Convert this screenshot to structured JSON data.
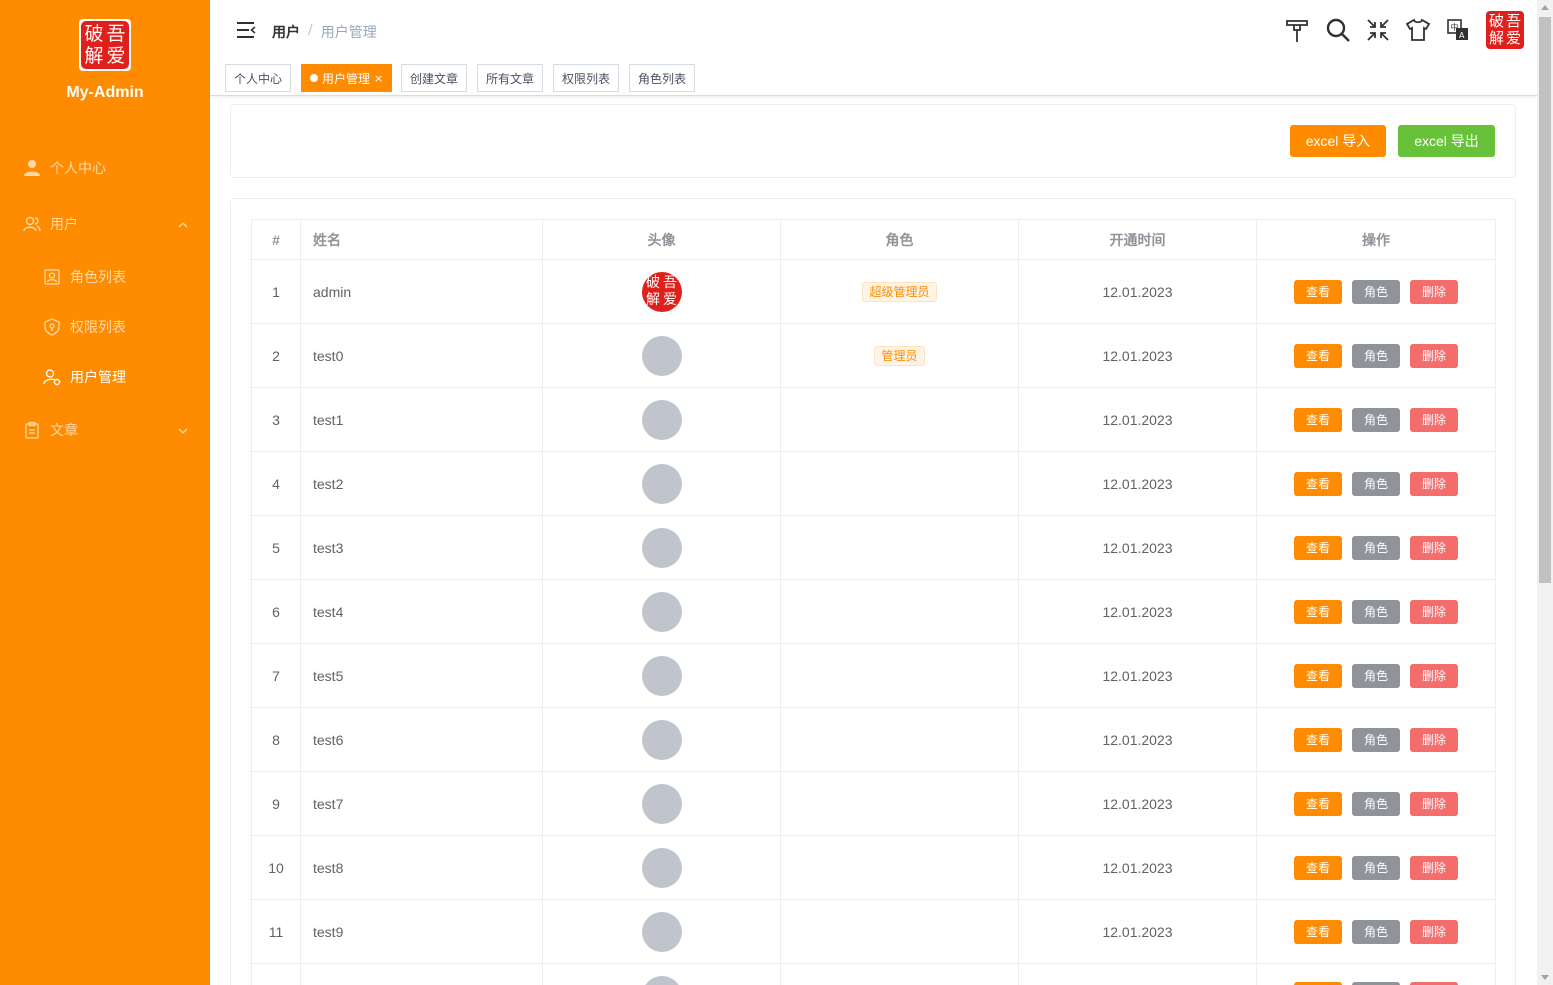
{
  "app": {
    "brand": "My-Admin",
    "logo_chars": [
      "破",
      "吾",
      "解",
      "爱"
    ]
  },
  "sidebar": {
    "items": [
      {
        "label": "个人中心",
        "icon": "user-icon"
      },
      {
        "label": "用户",
        "icon": "users-icon"
      },
      {
        "label": "角色列表",
        "icon": "role-icon"
      },
      {
        "label": "权限列表",
        "icon": "shield-icon"
      },
      {
        "label": "用户管理",
        "icon": "user-manage-icon"
      },
      {
        "label": "文章",
        "icon": "clipboard-icon"
      }
    ]
  },
  "header": {
    "breadcrumb": [
      "用户",
      "/",
      "用户管理"
    ],
    "icons": [
      "size-icon",
      "search-icon",
      "fullscreen-exit-icon",
      "theme-shirt-icon",
      "language-icon"
    ]
  },
  "tags": [
    {
      "label": "个人中心"
    },
    {
      "label": "用户管理",
      "close": "×"
    },
    {
      "label": "创建文章"
    },
    {
      "label": "所有文章"
    },
    {
      "label": "权限列表"
    },
    {
      "label": "角色列表"
    }
  ],
  "toolbar": {
    "import_label": "excel 导入",
    "export_label": "excel 导出"
  },
  "table": {
    "columns": [
      "#",
      "姓名",
      "头像",
      "角色",
      "开通时间",
      "操作"
    ],
    "actions": {
      "view": "查看",
      "role": "角色",
      "delete": "删除"
    },
    "rows": [
      {
        "index": "1",
        "name": "admin",
        "role": "超级管理员",
        "date": "12.01.2023",
        "avatar": "seal"
      },
      {
        "index": "2",
        "name": "test0",
        "role": "管理员",
        "date": "12.01.2023",
        "avatar": "placeholder"
      },
      {
        "index": "3",
        "name": "test1",
        "role": "",
        "date": "12.01.2023",
        "avatar": "placeholder"
      },
      {
        "index": "4",
        "name": "test2",
        "role": "",
        "date": "12.01.2023",
        "avatar": "placeholder"
      },
      {
        "index": "5",
        "name": "test3",
        "role": "",
        "date": "12.01.2023",
        "avatar": "placeholder"
      },
      {
        "index": "6",
        "name": "test4",
        "role": "",
        "date": "12.01.2023",
        "avatar": "placeholder"
      },
      {
        "index": "7",
        "name": "test5",
        "role": "",
        "date": "12.01.2023",
        "avatar": "placeholder"
      },
      {
        "index": "8",
        "name": "test6",
        "role": "",
        "date": "12.01.2023",
        "avatar": "placeholder"
      },
      {
        "index": "9",
        "name": "test7",
        "role": "",
        "date": "12.01.2023",
        "avatar": "placeholder"
      },
      {
        "index": "10",
        "name": "test8",
        "role": "",
        "date": "12.01.2023",
        "avatar": "placeholder"
      },
      {
        "index": "11",
        "name": "test9",
        "role": "",
        "date": "12.01.2023",
        "avatar": "placeholder"
      }
    ]
  },
  "colors": {
    "accent": "#ff8c00",
    "success": "#67c23a",
    "danger": "#f56c6c",
    "info": "#909399"
  }
}
